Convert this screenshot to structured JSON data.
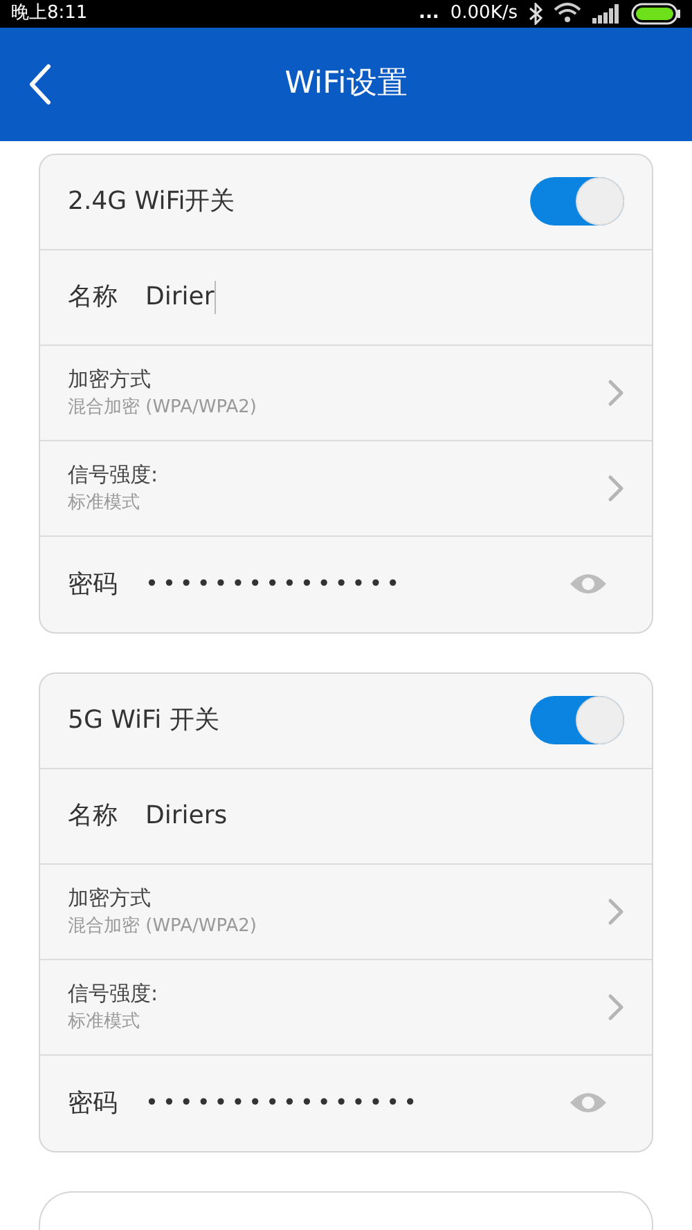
{
  "status_bar": {
    "time": "晚上8:11",
    "more": "...",
    "speed": "0.00K/s"
  },
  "header": {
    "title": "WiFi设置"
  },
  "cards": [
    {
      "switch_label": "2.4G WiFi开关",
      "on": true,
      "name_label": "名称",
      "name_value": "Dirier",
      "name_focused": true,
      "encryption_label": "加密方式",
      "encryption_value": "混合加密 (WPA/WPA2)",
      "signal_label": "信号强度:",
      "signal_value": "标准模式",
      "password_label": "密码",
      "password_value": "•••••••••••••••"
    },
    {
      "switch_label": "5G WiFi 开关",
      "on": true,
      "name_label": "名称",
      "name_value": "Diriers",
      "name_focused": false,
      "encryption_label": "加密方式",
      "encryption_value": "混合加密 (WPA/WPA2)",
      "signal_label": "信号强度:",
      "signal_value": "标准模式",
      "password_label": "密码",
      "password_value": "••••••••••••••••"
    }
  ]
}
